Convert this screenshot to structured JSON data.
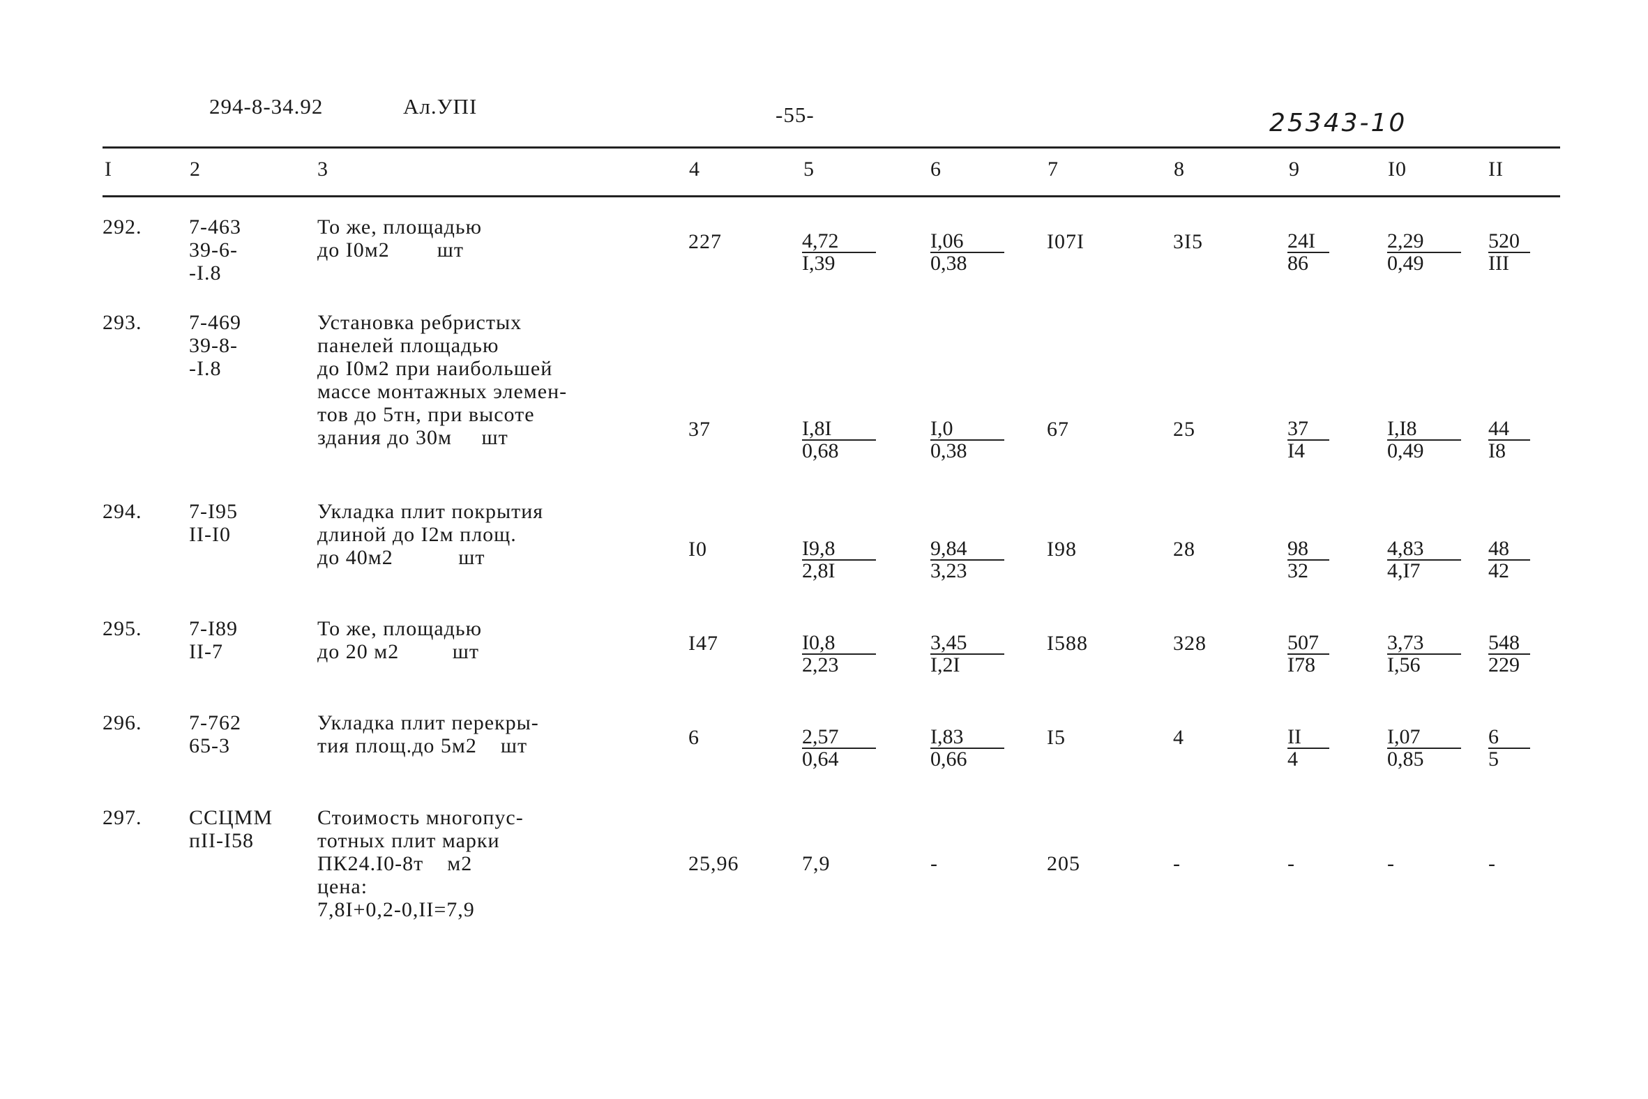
{
  "header": {
    "doc_code": "294-8-34.92",
    "album": "Ал.УПI",
    "page_number": "-55-",
    "handwritten_ref": "25343-10"
  },
  "columns": [
    "I",
    "2",
    "3",
    "4",
    "5",
    "6",
    "7",
    "8",
    "9",
    "I0",
    "II"
  ],
  "rows": [
    {
      "num": "292.",
      "code": [
        "7-463",
        "39-6-",
        "-I.8"
      ],
      "desc": [
        "То же, площадью",
        "до I0м2        шт"
      ],
      "c4": "227",
      "c5": {
        "top": "4,72",
        "bottom": "I,39"
      },
      "c6": {
        "top": "I,06",
        "bottom": "0,38"
      },
      "c7": "I07I",
      "c8": "3I5",
      "c9": {
        "top": "24I",
        "bottom": "86"
      },
      "c10": {
        "top": "2,29",
        "bottom": "0,49"
      },
      "c11": {
        "top": "520",
        "bottom": "III"
      }
    },
    {
      "num": "293.",
      "code": [
        "7-469",
        "39-8-",
        "-I.8"
      ],
      "desc": [
        "Установка ребристых",
        "панелей площадью",
        "до I0м2 при наибольшей",
        "массе монтажных элемен-",
        "тов до 5тн, при высоте",
        "здания до 30м     шт"
      ],
      "c4": "37",
      "c5": {
        "top": "I,8I",
        "bottom": "0,68"
      },
      "c6": {
        "top": "I,0",
        "bottom": "0,38"
      },
      "c7": "67",
      "c8": "25",
      "c9": {
        "top": "37",
        "bottom": "I4"
      },
      "c10": {
        "top": "I,I8",
        "bottom": "0,49"
      },
      "c11": {
        "top": "44",
        "bottom": "I8"
      }
    },
    {
      "num": "294.",
      "code": [
        "7-I95",
        "II-I0"
      ],
      "desc": [
        "Укладка плит покрытия",
        "длиной до I2м площ.",
        "до 40м2           шт"
      ],
      "c4": "I0",
      "c5": {
        "top": "I9,8",
        "bottom": "2,8I"
      },
      "c6": {
        "top": "9,84",
        "bottom": "3,23"
      },
      "c7": "I98",
      "c8": "28",
      "c9": {
        "top": "98",
        "bottom": "32"
      },
      "c10": {
        "top": "4,83",
        "bottom": "4,I7"
      },
      "c11": {
        "top": "48",
        "bottom": "42"
      }
    },
    {
      "num": "295.",
      "code": [
        "7-I89",
        "II-7"
      ],
      "desc": [
        "То же, площадью",
        "до 20 м2         шт"
      ],
      "c4": "I47",
      "c5": {
        "top": "I0,8",
        "bottom": "2,23"
      },
      "c6": {
        "top": "3,45",
        "bottom": "I,2I"
      },
      "c7": "I588",
      "c8": "328",
      "c9": {
        "top": "507",
        "bottom": "I78"
      },
      "c10": {
        "top": "3,73",
        "bottom": "I,56"
      },
      "c11": {
        "top": "548",
        "bottom": "229"
      }
    },
    {
      "num": "296.",
      "code": [
        "7-762",
        "65-3"
      ],
      "desc": [
        "Укладка плит перекры-",
        "тия площ.до 5м2    шт"
      ],
      "c4": "6",
      "c5": {
        "top": "2,57",
        "bottom": "0,64"
      },
      "c6": {
        "top": "I,83",
        "bottom": "0,66"
      },
      "c7": "I5",
      "c8": "4",
      "c9": {
        "top": "II",
        "bottom": "4"
      },
      "c10": {
        "top": "I,07",
        "bottom": "0,85"
      },
      "c11": {
        "top": "6",
        "bottom": "5"
      }
    },
    {
      "num": "297.",
      "code": [
        "ССЦММ",
        "пII-I58"
      ],
      "desc": [
        "Стоимость многопус-",
        "тотных плит марки",
        "ПК24.I0-8т    м2",
        "цена:",
        "7,8I+0,2-0,II=7,9"
      ],
      "c4": "25,96",
      "c5": "7,9",
      "c6": "-",
      "c7": "205",
      "c8": "-",
      "c9": "-",
      "c10": "-",
      "c11": "-"
    }
  ]
}
